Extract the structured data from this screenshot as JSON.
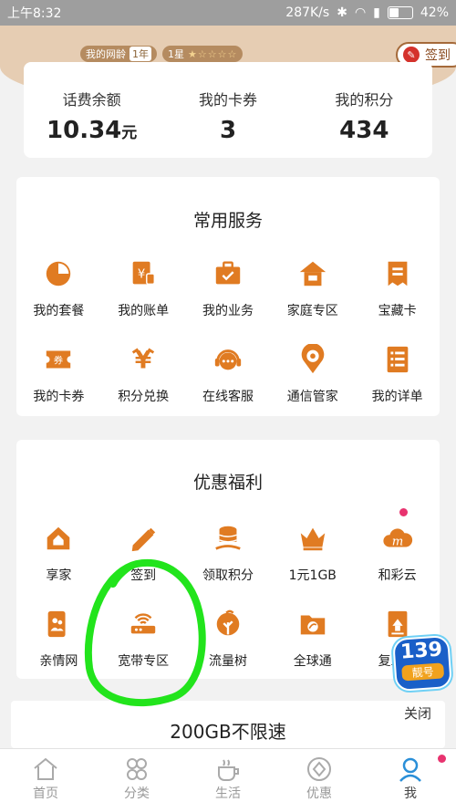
{
  "status_bar": {
    "time": "上午8:32",
    "speed": "287K/s",
    "battery": "42%"
  },
  "header": {
    "age_label": "我的网龄",
    "age_value": "1年",
    "star_label": "1星",
    "stars": "★☆☆☆☆",
    "signin_label": "签到"
  },
  "balance": [
    {
      "label": "话费余额",
      "value": "10.34",
      "unit": "元"
    },
    {
      "label": "我的卡券",
      "value": "3"
    },
    {
      "label": "我的积分",
      "value": "434"
    }
  ],
  "services": {
    "title": "常用服务",
    "items": [
      {
        "label": "我的套餐",
        "icon": "pie-chart-icon"
      },
      {
        "label": "我的账单",
        "icon": "bill-icon"
      },
      {
        "label": "我的业务",
        "icon": "briefcase-icon"
      },
      {
        "label": "家庭专区",
        "icon": "home-icon"
      },
      {
        "label": "宝藏卡",
        "icon": "card-icon"
      },
      {
        "label": "我的卡券",
        "icon": "coupon-icon"
      },
      {
        "label": "积分兑换",
        "icon": "exchange-icon"
      },
      {
        "label": "在线客服",
        "icon": "headset-icon"
      },
      {
        "label": "通信管家",
        "icon": "location-signal-icon"
      },
      {
        "label": "我的详单",
        "icon": "list-icon"
      }
    ]
  },
  "benefits": {
    "title": "优惠福利",
    "items": [
      {
        "label": "享家",
        "icon": "house-icon"
      },
      {
        "label": "签到",
        "icon": "pencil-icon"
      },
      {
        "label": "领取积分",
        "icon": "coins-icon"
      },
      {
        "label": "1元1GB",
        "icon": "crown-icon"
      },
      {
        "label": "和彩云",
        "icon": "cloud-icon"
      },
      {
        "label": "亲情网",
        "icon": "family-icon"
      },
      {
        "label": "宽带专区",
        "icon": "router-icon"
      },
      {
        "label": "流量树",
        "icon": "tree-icon"
      },
      {
        "label": "全球通",
        "icon": "globe-card-icon"
      },
      {
        "label": "复工助",
        "icon": "document-icon"
      }
    ]
  },
  "float_promo": {
    "number": "139",
    "sub": "靓号",
    "close_label": "关闭"
  },
  "promo_banner": {
    "text": "200GB不限速"
  },
  "bottom_nav": [
    {
      "label": "首页",
      "icon": "home-outline-icon"
    },
    {
      "label": "分类",
      "icon": "grid-outline-icon"
    },
    {
      "label": "生活",
      "icon": "cup-icon"
    },
    {
      "label": "优惠",
      "icon": "discount-icon"
    },
    {
      "label": "我",
      "icon": "profile-icon"
    }
  ],
  "colors": {
    "accent": "#e07b22",
    "annotation": "#22e41c",
    "header": "#e6cdb3"
  }
}
